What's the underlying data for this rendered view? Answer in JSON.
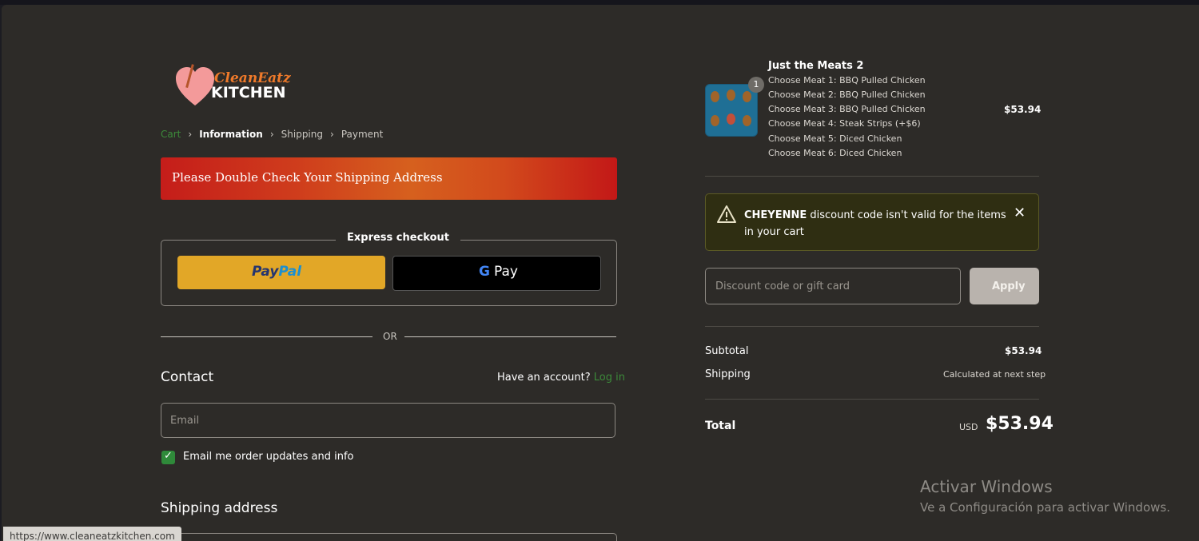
{
  "brand": {
    "logo_top": "CleanEatz",
    "logo_bottom": "KITCHEN"
  },
  "breadcrumb": {
    "cart": "Cart",
    "information": "Information",
    "shipping": "Shipping",
    "payment": "Payment"
  },
  "banner": {
    "text": "Please Double Check Your Shipping Address"
  },
  "express": {
    "title": "Express checkout",
    "paypal_a": "Pay",
    "paypal_b": "Pal",
    "gpay_g": "G",
    "gpay_label": "Pay"
  },
  "divider": {
    "or": "OR"
  },
  "contact": {
    "heading": "Contact",
    "have_account": "Have an account?",
    "login": "Log in",
    "email_placeholder": "Email",
    "checkbox_label": "Email me order updates and info",
    "checkbox_checked": true
  },
  "shipping": {
    "heading": "Shipping address"
  },
  "product": {
    "name": "Just the Meats 2",
    "quantity": "1",
    "price": "$53.94",
    "options": [
      "Choose Meat 1: BBQ Pulled Chicken",
      "Choose Meat 2: BBQ Pulled Chicken",
      "Choose Meat 3: BBQ Pulled Chicken",
      "Choose Meat 4: Steak Strips (+$6)",
      "Choose Meat 5: Diced Chicken",
      "Choose Meat 6: Diced Chicken"
    ]
  },
  "warning": {
    "code": "CHEYENNE",
    "message": " discount code isn't valid for the items in your cart"
  },
  "discount": {
    "placeholder": "Discount code or gift card",
    "apply": "Apply"
  },
  "summary": {
    "subtotal_label": "Subtotal",
    "subtotal_value": "$53.94",
    "shipping_label": "Shipping",
    "shipping_value": "Calculated at next step",
    "total_label": "Total",
    "currency": "USD",
    "total_value": "$53.94"
  },
  "watermark": {
    "line1": "Activar Windows",
    "line2": "Ve a Configuración para activar Windows."
  },
  "status_bar": {
    "url": "https://www.cleaneatzkitchen.com"
  },
  "colors": {
    "background": "#2d2b28",
    "banner_red": "#c51d1a",
    "paypal_yellow": "#e2a727",
    "link_green": "#3c8a3a",
    "warning_bg": "#2f2e12"
  }
}
